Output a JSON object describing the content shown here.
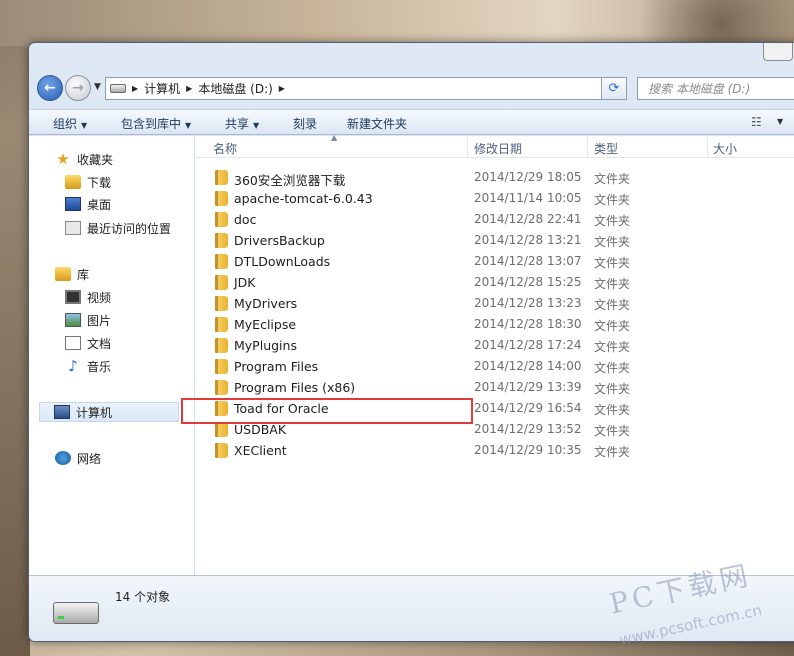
{
  "address": {
    "crumbs": [
      "计算机",
      "本地磁盘 (D:)"
    ],
    "search_placeholder": "搜索 本地磁盘 (D:)"
  },
  "toolbar": {
    "organize": "组织",
    "include_in_library": "包含到库中",
    "share": "共享",
    "burn": "刻录",
    "new_folder": "新建文件夹"
  },
  "sidebar": {
    "favorites": {
      "title": "收藏夹",
      "items": [
        "下载",
        "桌面",
        "最近访问的位置"
      ]
    },
    "libraries": {
      "title": "库",
      "items": [
        "视频",
        "图片",
        "文档",
        "音乐"
      ]
    },
    "computer": "计算机",
    "network": "网络"
  },
  "columns": {
    "name": "名称",
    "date_modified": "修改日期",
    "type": "类型",
    "size": "大小"
  },
  "files": [
    {
      "name": "360安全浏览器下载",
      "date": "2014/12/29 18:05",
      "type": "文件夹"
    },
    {
      "name": "apache-tomcat-6.0.43",
      "date": "2014/11/14 10:05",
      "type": "文件夹"
    },
    {
      "name": "doc",
      "date": "2014/12/28 22:41",
      "type": "文件夹"
    },
    {
      "name": "DriversBackup",
      "date": "2014/12/28 13:21",
      "type": "文件夹"
    },
    {
      "name": "DTLDownLoads",
      "date": "2014/12/28 13:07",
      "type": "文件夹"
    },
    {
      "name": "JDK",
      "date": "2014/12/28 15:25",
      "type": "文件夹"
    },
    {
      "name": "MyDrivers",
      "date": "2014/12/28 13:23",
      "type": "文件夹"
    },
    {
      "name": "MyEclipse",
      "date": "2014/12/28 18:30",
      "type": "文件夹"
    },
    {
      "name": "MyPlugins",
      "date": "2014/12/28 17:24",
      "type": "文件夹"
    },
    {
      "name": "Program Files",
      "date": "2014/12/28 14:00",
      "type": "文件夹"
    },
    {
      "name": "Program Files (x86)",
      "date": "2014/12/29 13:39",
      "type": "文件夹"
    },
    {
      "name": "Toad for Oracle",
      "date": "2014/12/29 16:54",
      "type": "文件夹"
    },
    {
      "name": "USDBAK",
      "date": "2014/12/29 13:52",
      "type": "文件夹"
    },
    {
      "name": "XEClient",
      "date": "2014/12/29 10:35",
      "type": "文件夹"
    }
  ],
  "details": {
    "count": "14 个对象"
  },
  "watermark": {
    "brand": "PC下载网",
    "url": "www.pcsoft.com.cn"
  }
}
